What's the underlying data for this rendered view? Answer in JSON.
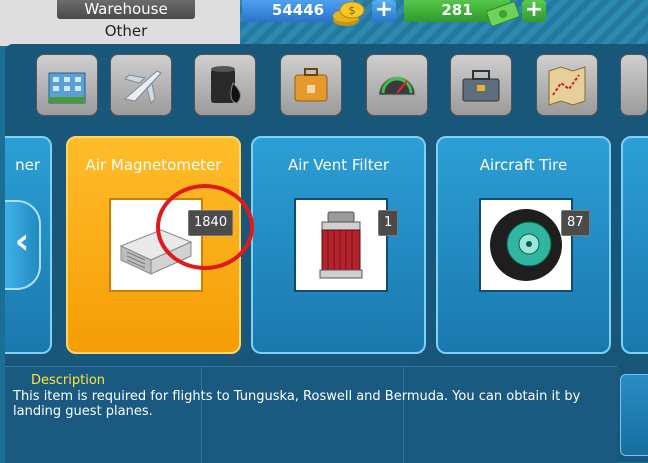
{
  "header": {
    "tabs": [
      {
        "label": "Warehouse"
      },
      {
        "label": "Other"
      }
    ],
    "resources": {
      "coins": "54446",
      "cash": "281"
    },
    "icons": {
      "coins": "coin-stack-icon",
      "cash": "banknote-icon",
      "plus": "plus-icon"
    }
  },
  "categories": [
    {
      "name": "building-icon"
    },
    {
      "name": "airplane-icon"
    },
    {
      "name": "oil-barrel-icon"
    },
    {
      "name": "suitcase-icon"
    },
    {
      "name": "gauge-icon"
    },
    {
      "name": "toolbox-icon"
    },
    {
      "name": "map-icon"
    }
  ],
  "items": [
    {
      "title": "ner",
      "count": ""
    },
    {
      "title": "Air Magnetometer",
      "count": "1840",
      "selected": true,
      "icon": "magnetometer-icon"
    },
    {
      "title": "Air Vent Filter",
      "count": "1",
      "icon": "air-filter-icon"
    },
    {
      "title": "Aircraft Tire",
      "count": "87",
      "icon": "tire-icon"
    }
  ],
  "description": {
    "heading": "Description",
    "text": "This item is required for flights to Tunguska, Roswell and Bermuda. You can obtain it by landing guest planes."
  },
  "colors": {
    "selected_card": "#f5a20a",
    "card": "#2190c8",
    "annotation": "#e01a1a",
    "desc_heading": "#ffe53a"
  }
}
